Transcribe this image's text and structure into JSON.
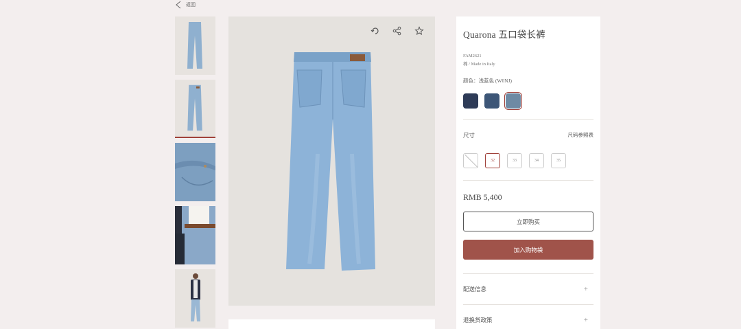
{
  "nav": {
    "back_label": "返回"
  },
  "product": {
    "title": "Quarona 五口袋长裤",
    "sku": "FAM2621",
    "material": "棉 / Made in Italy",
    "color_label": "颜色：浅蓝色 (W0NJ)",
    "swatches": [
      {
        "name": "dark-indigo",
        "color": "#2e3b57"
      },
      {
        "name": "mid-indigo",
        "color": "#3d5677"
      },
      {
        "name": "light-blue",
        "color": "#6e8aa4",
        "selected": true
      }
    ],
    "size_label": "尺寸",
    "size_guide_label": "尺码参照表",
    "sizes": [
      {
        "label": "",
        "available": false
      },
      {
        "label": "32",
        "selected": true
      },
      {
        "label": "33"
      },
      {
        "label": "34"
      },
      {
        "label": "35"
      }
    ],
    "price": "RMB 5,400",
    "buy_now_label": "立即购买",
    "add_to_bag_label": "加入购物袋"
  },
  "accordions": [
    {
      "label": "配送信息"
    },
    {
      "label": "退换货政策"
    }
  ],
  "image_tools": [
    "rotate-360-icon",
    "share-icon",
    "star-icon"
  ],
  "colors": {
    "accent": "#a0413a",
    "cart_button": "#a0534a",
    "page_bg": "#f3eeee"
  }
}
